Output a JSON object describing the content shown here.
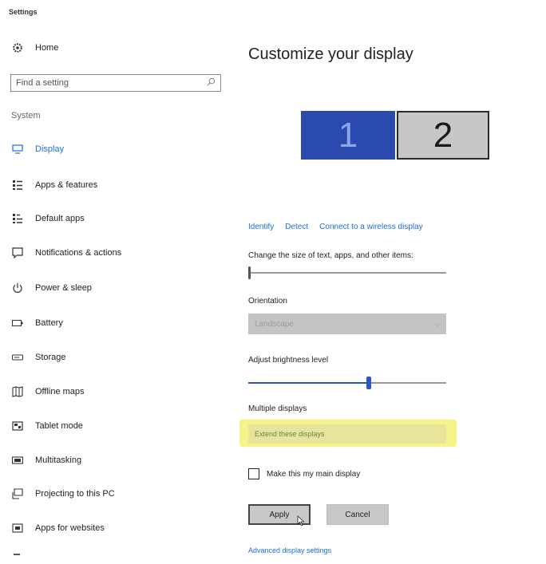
{
  "window": {
    "title": "Settings"
  },
  "sidebar": {
    "home": {
      "label": "Home",
      "icon": "gear-icon"
    },
    "search": {
      "placeholder": "Find a setting"
    },
    "section": "System",
    "items": [
      {
        "label": "Display",
        "icon": "display-icon",
        "active": true
      },
      {
        "label": "Apps & features",
        "icon": "apps-features-icon"
      },
      {
        "label": "Default apps",
        "icon": "default-apps-icon"
      },
      {
        "label": "Notifications & actions",
        "icon": "notifications-icon"
      },
      {
        "label": "Power & sleep",
        "icon": "power-icon"
      },
      {
        "label": "Battery",
        "icon": "battery-icon"
      },
      {
        "label": "Storage",
        "icon": "storage-icon"
      },
      {
        "label": "Offline maps",
        "icon": "map-icon"
      },
      {
        "label": "Tablet mode",
        "icon": "tablet-icon"
      },
      {
        "label": "Multitasking",
        "icon": "multitasking-icon"
      },
      {
        "label": "Projecting to this PC",
        "icon": "projecting-icon"
      },
      {
        "label": "Apps for websites",
        "icon": "apps-websites-icon"
      }
    ]
  },
  "main": {
    "heading": "Customize your display",
    "monitors": [
      "1",
      "2"
    ],
    "links": {
      "identify": "Identify",
      "detect": "Detect",
      "connect": "Connect to a wireless display"
    },
    "size_label": "Change the size of text, apps, and other items:",
    "size_level": 0,
    "orientation_label": "Orientation",
    "orientation_value": "Landscape",
    "brightness_label": "Adjust brightness level",
    "brightness_level": 0.61,
    "multiple_label": "Multiple displays",
    "multiple_value": "Extend these displays",
    "main_display_label": "Make this my main display",
    "apply": "Apply",
    "cancel": "Cancel",
    "advanced": "Advanced display settings"
  },
  "colors": {
    "accent": "#1e6fd8",
    "monitor_selected": "#2a4ab0",
    "highlight": "#f6f488"
  }
}
